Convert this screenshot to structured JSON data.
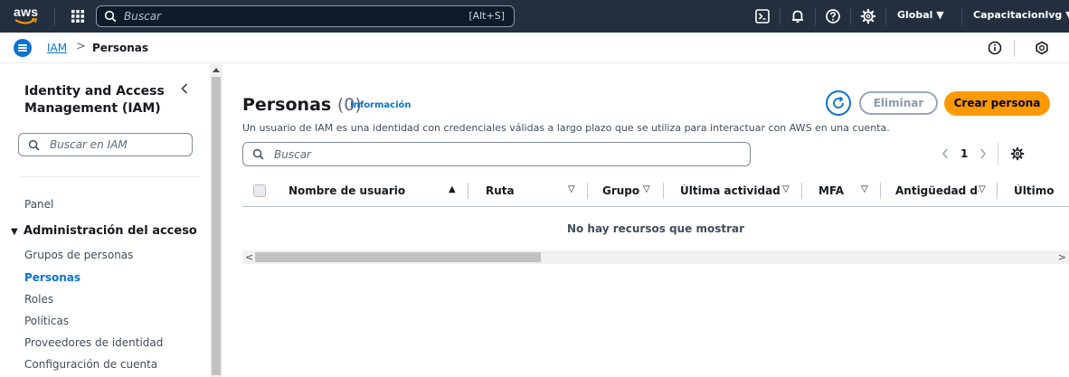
{
  "topnav": {
    "logo": "aws",
    "search_placeholder": "Buscar",
    "search_shortcut": "[Alt+S]",
    "region": "Global ▼",
    "account": "Capacitacionlvg ▼",
    "icons": [
      "apps-grid-icon",
      "search-icon",
      "cloudshell-icon",
      "bell-icon",
      "help-icon",
      "gear-icon"
    ]
  },
  "breadcrumb": {
    "root": "IAM",
    "separator": ">",
    "current": "Personas"
  },
  "sidebar": {
    "title": "Identity and Access Management (IAM)",
    "search_placeholder": "Buscar en IAM",
    "panel": "Panel",
    "section": "Administración del acceso",
    "items": [
      {
        "label": "Grupos de personas",
        "active": false
      },
      {
        "label": "Personas",
        "active": true
      },
      {
        "label": "Roles",
        "active": false
      },
      {
        "label": "Políticas",
        "active": false
      },
      {
        "label": "Proveedores de identidad",
        "active": false
      },
      {
        "label": "Configuración de cuenta",
        "active": false
      }
    ]
  },
  "main": {
    "title": "Personas",
    "count": "(0)",
    "info_link": "Información",
    "description": "Un usuario de IAM es una identidad con credenciales válidas a largo plazo que se utiliza para interactuar con AWS en una cuenta.",
    "delete_label": "Eliminar",
    "create_label": "Crear persona",
    "search_placeholder": "Buscar",
    "page_number": "1",
    "columns": [
      {
        "label": "Nombre de usuario",
        "sort": "▲"
      },
      {
        "label": "Ruta",
        "sort": "▽"
      },
      {
        "label": "Grupos",
        "sort": "▽"
      },
      {
        "label": "Última actividad",
        "sort": "▽"
      },
      {
        "label": "MFA",
        "sort": "▽"
      },
      {
        "label": "Antigüedad de",
        "sort": "▽"
      },
      {
        "label": "Último",
        "sort": ""
      }
    ],
    "empty_message": "No hay recursos que mostrar"
  },
  "colors": {
    "nav_bg": "#232f3e",
    "link_blue": "#0972d3",
    "primary_orange": "#ff9900"
  }
}
